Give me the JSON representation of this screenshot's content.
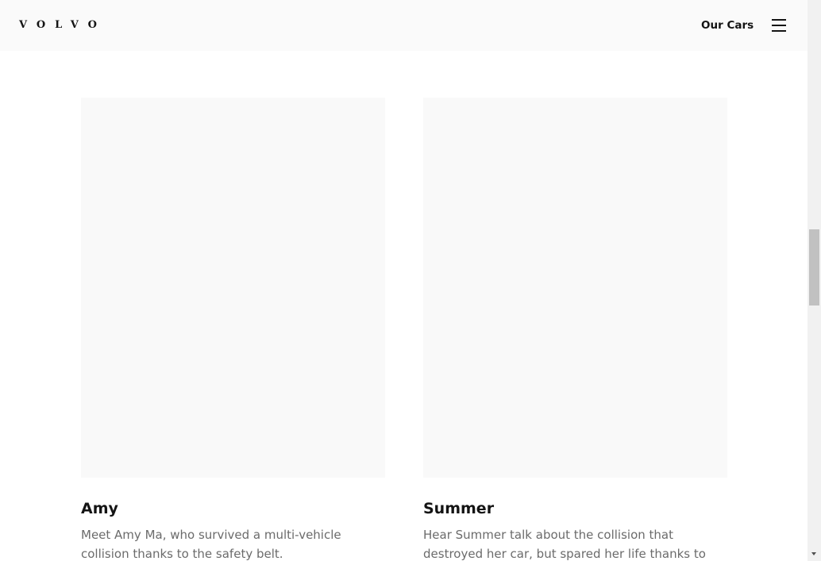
{
  "header": {
    "logo_text": "VOLVO",
    "nav_link": "Our Cars",
    "menu_icon": "hamburger-menu-icon"
  },
  "stories": [
    {
      "name": "Amy",
      "description": "Meet Amy Ma, who survived a multi-vehicle collision thanks to the safety belt."
    },
    {
      "name": "Summer",
      "description": "Hear Summer talk about the collision that destroyed her car, but spared her life thanks to the safety belt."
    }
  ],
  "colors": {
    "header_bg": "#fafafa",
    "card_placeholder_bg": "#f9f9f9",
    "title_text": "#141414",
    "description_text": "#6b6b6b"
  }
}
